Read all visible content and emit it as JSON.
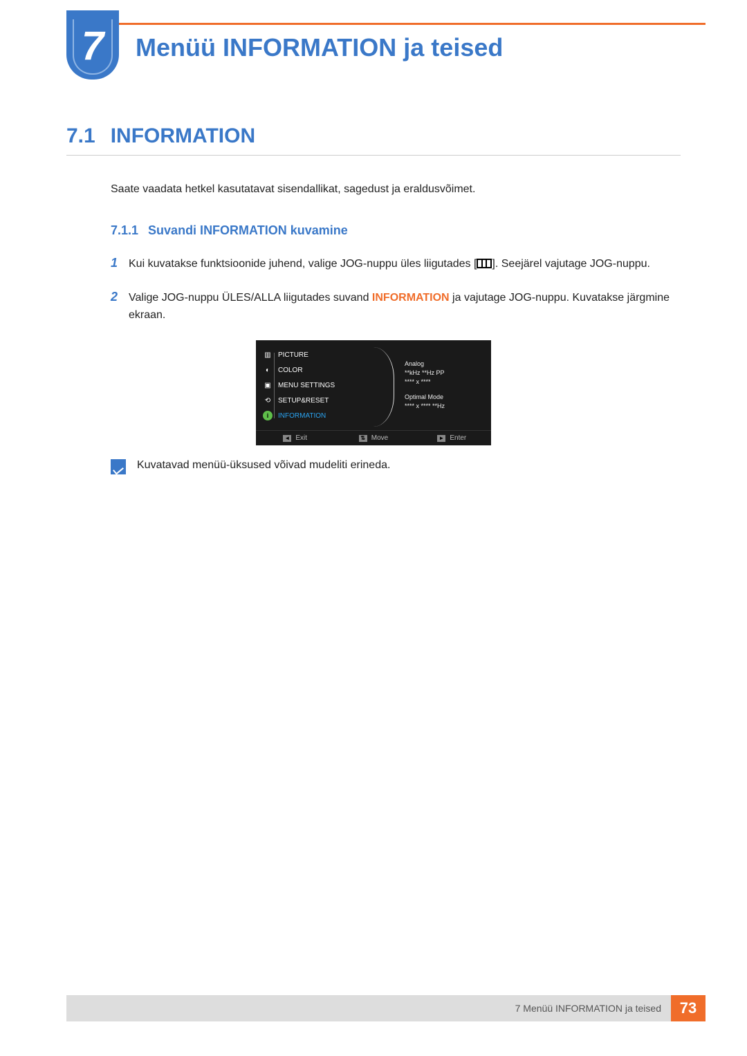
{
  "chapter": {
    "number": "7",
    "title": "Menüü INFORMATION ja teised"
  },
  "section": {
    "number": "7.1",
    "title": "INFORMATION",
    "intro": "Saate vaadata hetkel kasutatavat sisendallikat, sagedust ja eraldusvõimet."
  },
  "subsection": {
    "number": "7.1.1",
    "title": "Suvandi INFORMATION kuvamine"
  },
  "steps": {
    "s1": {
      "num": "1",
      "a": "Kui kuvatakse funktsioonide juhend, valige JOG-nuppu üles liigutades [",
      "b": "]. Seejärel vajutage JOG-nuppu."
    },
    "s2": {
      "num": "2",
      "a": "Valige JOG-nuppu ÜLES/ALLA liigutades suvand ",
      "kw": "INFORMATION",
      "b": " ja vajutage JOG-nuppu. Kuvatakse järgmine ekraan."
    }
  },
  "osd": {
    "menu": {
      "picture": "PICTURE",
      "color": "COLOR",
      "menu_settings": "MENU SETTINGS",
      "setup_reset": "SETUP&RESET",
      "information": "INFORMATION"
    },
    "info": {
      "l1": "Analog",
      "l2": "**kHz **Hz PP",
      "l3": "**** x ****",
      "l4": "Optimal Mode",
      "l5": "**** x **** **Hz"
    },
    "footer": {
      "exit": "Exit",
      "move": "Move",
      "enter": "Enter"
    }
  },
  "note": "Kuvatavad menüü-üksused võivad mudeliti erineda.",
  "footer": {
    "text": "7 Menüü INFORMATION ja teised",
    "page": "73"
  }
}
